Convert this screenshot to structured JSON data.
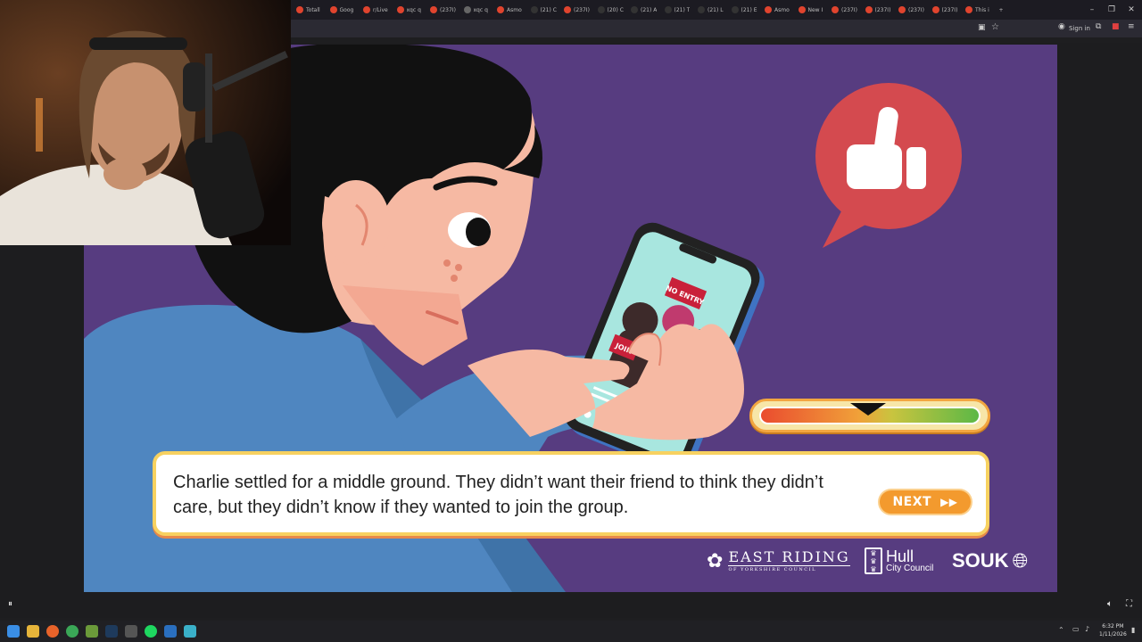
{
  "browser": {
    "tabs": [
      {
        "label": "Totall",
        "color": "#e0442e"
      },
      {
        "label": "Goog",
        "color": "#e0442e"
      },
      {
        "label": "r/Live",
        "color": "#e0442e"
      },
      {
        "label": "xqc q",
        "color": "#e0442e"
      },
      {
        "label": "(237I)",
        "color": "#e0442e"
      },
      {
        "label": "xqc q",
        "color": "#666666"
      },
      {
        "label": "Asmo",
        "color": "#e0442e"
      },
      {
        "label": "(21) C",
        "color": "#333333"
      },
      {
        "label": "(237I)",
        "color": "#e0442e"
      },
      {
        "label": "(20) C",
        "color": "#333333"
      },
      {
        "label": "(21) A",
        "color": "#333333"
      },
      {
        "label": "(21) T",
        "color": "#333333"
      },
      {
        "label": "(21) L",
        "color": "#333333"
      },
      {
        "label": "(21) E",
        "color": "#333333"
      },
      {
        "label": "Asmo",
        "color": "#e0442e"
      },
      {
        "label": "New I",
        "color": "#e0442e"
      },
      {
        "label": "(237I)",
        "color": "#e0442e"
      },
      {
        "label": "(237I)",
        "color": "#e0442e"
      },
      {
        "label": "(237I)",
        "color": "#e0442e"
      },
      {
        "label": "(237I)",
        "color": "#e0442e"
      },
      {
        "label": "This i",
        "color": "#e0442e"
      }
    ],
    "sign_in": "Sign in"
  },
  "game": {
    "dialog_text": "Charlie settled for a middle ground. They didn’t want their friend to think they didn’t care, but they didn’t know if they wanted to join the group.",
    "next_label": "NEXT",
    "meter_value": 0.49,
    "phone_sign_text": "NO ENTRY",
    "phone_join_text": "JOIN",
    "logos": {
      "east_riding": "EAST RIDING",
      "east_riding_sub": "OF YORKSHIRE COUNCIL",
      "hull": "Hull",
      "hull_sub": "City Council",
      "souk": "SOUK"
    }
  },
  "taskbar": {
    "time": "6:32 PM",
    "date": "1/11/2026"
  }
}
